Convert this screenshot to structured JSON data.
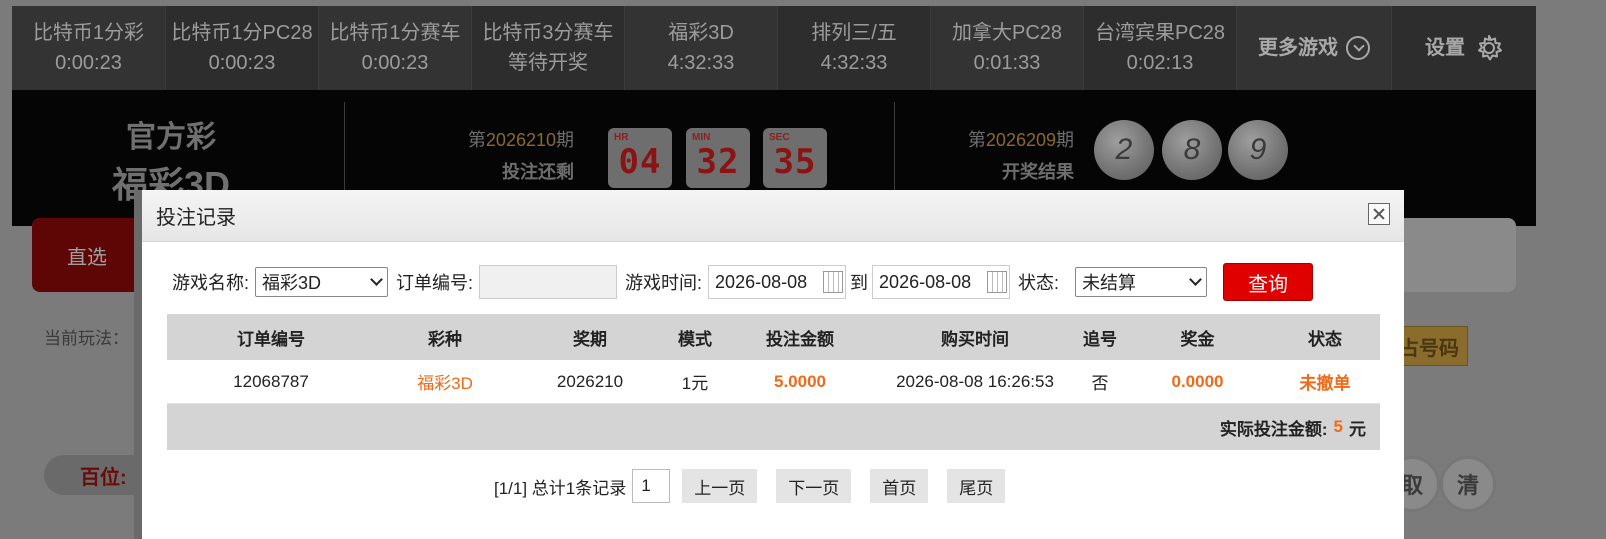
{
  "top_tabs": [
    {
      "name": "比特币1分彩",
      "time": "0:00:23"
    },
    {
      "name": "比特币1分PC28",
      "time": "0:00:23"
    },
    {
      "name": "比特币1分赛车",
      "time": "0:00:23"
    },
    {
      "name": "比特币3分赛车",
      "time": "等待开奖"
    },
    {
      "name": "福彩3D",
      "time": "4:32:33"
    },
    {
      "name": "排列三/五",
      "time": "4:32:33"
    },
    {
      "name": "加拿大PC28",
      "time": "0:01:33"
    },
    {
      "name": "台湾宾果PC28",
      "time": "0:02:13"
    }
  ],
  "more_games": "更多游戏",
  "settings": "设置",
  "brand": {
    "line1": "官方彩",
    "line2": "福彩3D"
  },
  "current_issue": {
    "prefix": "第",
    "number": "2026210",
    "suffix": "期",
    "status": "投注还剩"
  },
  "countdown": {
    "hr_tag": "HR",
    "hr": "04",
    "min_tag": "MIN",
    "min": "32",
    "sec_tag": "SEC",
    "sec": "35"
  },
  "last_issue": {
    "prefix": "第",
    "number": "2026209",
    "suffix": "期",
    "status": "开奖结果",
    "balls": [
      "2",
      "8",
      "9"
    ]
  },
  "background": {
    "zhixuan": "直选",
    "current_play": "当前玩法：",
    "bet_button": "占号码",
    "row_label": "百位:",
    "round_a": "取",
    "round_b": "清"
  },
  "modal": {
    "title": "投注记录",
    "filters": {
      "game_label": "游戏名称:",
      "game_value": "福彩3D",
      "order_label": "订单编号:",
      "order_value": "",
      "time_label": "游戏时间:",
      "date_from": "2026-08-08",
      "to_label": "到",
      "date_to": "2026-08-08",
      "status_label": "状态:",
      "status_value": "未结算",
      "query_button": "查询"
    },
    "table": {
      "headers": [
        "订单编号",
        "彩种",
        "奖期",
        "模式",
        "投注金额",
        "购买时间",
        "追号",
        "奖金",
        "状态"
      ],
      "rows": [
        [
          "12068787",
          "福彩3D",
          "2026210",
          "1元",
          "5.0000",
          "2026-08-08 16:26:53",
          "否",
          "0.0000",
          "未撤单"
        ]
      ],
      "total_label": "实际投注金额:",
      "total_value": "5",
      "total_unit": "元"
    },
    "pager": {
      "summary": "[1/1] 总计1条记录",
      "current": "1",
      "prev": "上一页",
      "next": "下一页",
      "first": "首页",
      "last": "尾页"
    }
  }
}
